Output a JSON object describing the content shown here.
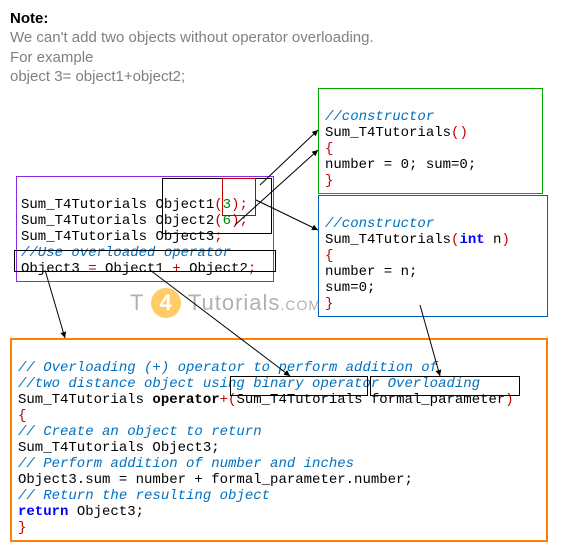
{
  "note": {
    "heading": "Note:",
    "line1": "We can't add two objects without operator overloading.",
    "line2": "For example",
    "line3": "object 3= object1+object2;"
  },
  "constructor_default": {
    "comment": "//constructor",
    "sig_name": "Sum_T4Tutorials",
    "paren_open": "(",
    "paren_close": ")",
    "brace_open": "{",
    "body": "number = 0; sum=0;",
    "brace_close": "}"
  },
  "constructor_param": {
    "comment": "//constructor",
    "sig_name": "Sum_T4Tutorials",
    "paren_open": "(",
    "param_type": "int",
    "param_name": " n",
    "paren_close": ")",
    "brace_open": "{",
    "body1": "number = n;",
    "body2": "sum=0;",
    "brace_close": "}"
  },
  "decl": {
    "type": "Sum_T4Tutorials",
    "obj1": "Object1",
    "arg1_open": "(",
    "arg1_val": "3",
    "arg1_close": ")",
    "semi": ";",
    "obj2": "Object2",
    "arg2_open": "(",
    "arg2_val": "6",
    "arg2_close": ")",
    "obj3": "Object3",
    "comment_overload": "//Use overloaded operator",
    "assign_lhs": "Object3",
    "assign_eq": " = ",
    "assign_r1": "Object1",
    "assign_plus": " + ",
    "assign_r2": "Object2",
    "assign_semi": ";"
  },
  "operator_fn": {
    "comment1": "// Overloading (+) operator to perform addition of",
    "comment2": "//two distance object using binary operator Overloading",
    "ret_type": "Sum_T4Tutorials ",
    "op_kw": "operator",
    "op_sym": "+",
    "paren_open": "(",
    "param_type": "Sum_T4Tutorials ",
    "param_name": "formal_parameter",
    "paren_close": ")",
    "brace_open": "{",
    "comment3": "// Create an object to return",
    "line_decl": "Sum_T4Tutorials Object3;",
    "comment4": "// Perform addition of number and inches",
    "line_sum": "Object3.sum = number + formal_parameter.number;",
    "comment5": "// Return the resulting object",
    "ret_kw": "return",
    "ret_val": " Object3;",
    "brace_close": "}"
  },
  "watermark": {
    "t": "T",
    "four": "4",
    "rest": "Tutorials",
    "dotcom": ".COM"
  }
}
